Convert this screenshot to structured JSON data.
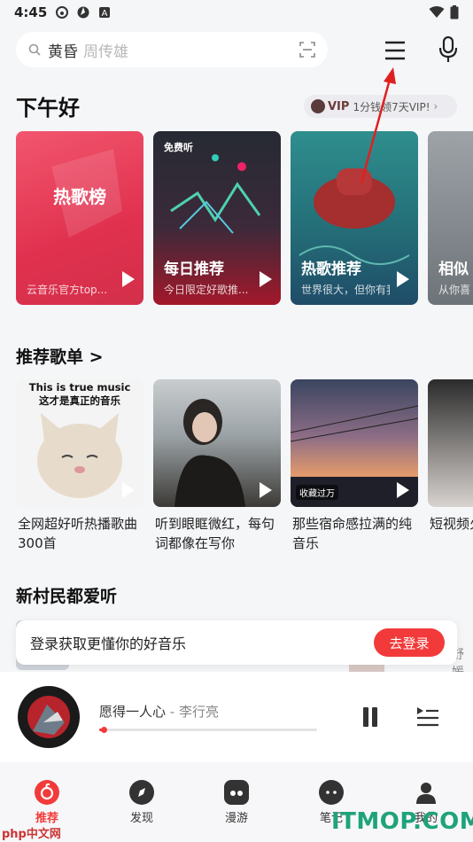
{
  "status_bar": {
    "time": "4:45"
  },
  "search": {
    "term": "黄昏",
    "hint": "周传雄"
  },
  "greeting": "下午好",
  "vip": {
    "tag": "VIP",
    "text": "1分钱领7天VIP!"
  },
  "cards": [
    {
      "title": "",
      "center": "热歌榜",
      "subtitle": "云音乐官方top...",
      "badge": ""
    },
    {
      "title": "每日推荐",
      "center": "",
      "subtitle": "今日限定好歌推...",
      "badge": "免费听"
    },
    {
      "title": "热歌推荐",
      "center": "",
      "subtitle": "世界很大，但你有我...",
      "badge": ""
    },
    {
      "title": "相似",
      "center": "",
      "subtitle": "从你喜",
      "badge": ""
    }
  ],
  "playlists_section": {
    "title": "推荐歌单",
    "chevron": ">"
  },
  "playlists": [
    {
      "title": "全网超好听热播歌曲300首",
      "cover_line1": "This is true music",
      "cover_line2": "这才是真正的音乐",
      "badge": ""
    },
    {
      "title": "听到眼眶微红，每句词都像在写你",
      "cover_line1": "",
      "cover_line2": "",
      "badge": ""
    },
    {
      "title": "那些宿命感拉满的纯音乐",
      "cover_line1": "",
      "cover_line2": "",
      "badge": "收藏过万"
    },
    {
      "title": "短视频火的流行",
      "cover_line1": "",
      "cover_line2": "",
      "badge": ""
    }
  ],
  "new_section": {
    "title": "新村民都爱听"
  },
  "login_banner": {
    "text": "登录获取更懂你的好音乐",
    "button": "去登录",
    "peek": "舒媛"
  },
  "player": {
    "song": "愿得一人心",
    "separator": " - ",
    "artist": "李行亮",
    "progress": 0.02
  },
  "bottom_nav": [
    {
      "label": "推荐",
      "active": true
    },
    {
      "label": "发现",
      "active": false
    },
    {
      "label": "漫游",
      "active": false
    },
    {
      "label": "笔记",
      "active": false
    },
    {
      "label": "我的",
      "active": false
    }
  ],
  "watermarks": {
    "right": "ITMOP.COM",
    "left": "php中文网"
  },
  "colors": {
    "accent": "#f23a3a",
    "background": "#f5f6f8",
    "annotation": "#e02020"
  }
}
